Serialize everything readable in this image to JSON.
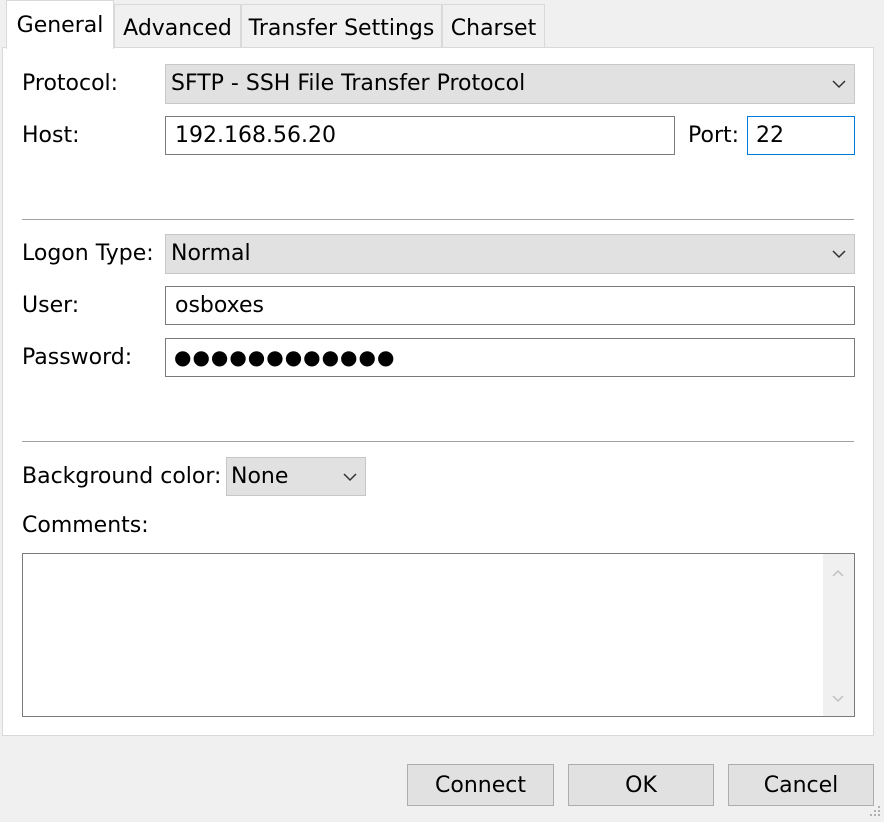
{
  "tabs": [
    {
      "label": "General",
      "active": true
    },
    {
      "label": "Advanced",
      "active": false
    },
    {
      "label": "Transfer Settings",
      "active": false
    },
    {
      "label": "Charset",
      "active": false
    }
  ],
  "general": {
    "protocol_label": "Protocol:",
    "protocol_value": "SFTP - SSH File Transfer Protocol",
    "host_label": "Host:",
    "host_value": "192.168.56.20",
    "port_label": "Port:",
    "port_value": "22",
    "logon_type_label": "Logon Type:",
    "logon_type_value": "Normal",
    "user_label": "User:",
    "user_value": "osboxes",
    "password_label": "Password:",
    "password_mask": "●●●●●●●●●●●●",
    "bg_color_label": "Background color:",
    "bg_color_value": "None",
    "comments_label": "Comments:",
    "comments_value": ""
  },
  "buttons": {
    "connect": "Connect",
    "ok": "OK",
    "cancel": "Cancel"
  },
  "icons": {
    "dropdown": "chevron-down-icon",
    "scroll_up": "scroll-up-arrow-icon",
    "scroll_down": "scroll-down-arrow-icon",
    "resize": "resize-grip-icon"
  },
  "colors": {
    "focus_border": "#0078d7",
    "window_bg": "#f0f0f0",
    "panel_bg": "#ffffff",
    "button_bg": "#e1e1e1"
  }
}
